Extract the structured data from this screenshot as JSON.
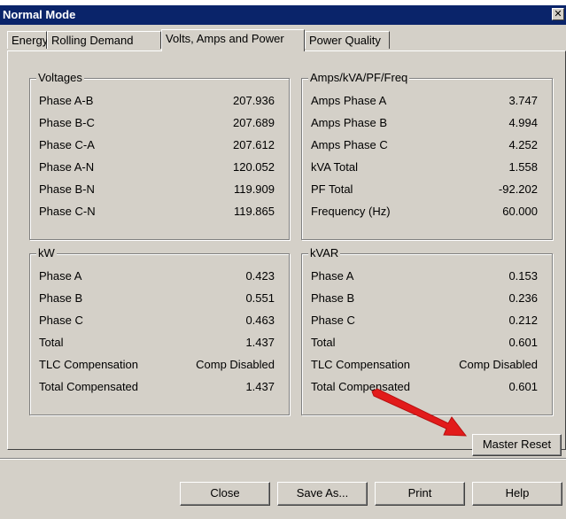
{
  "window": {
    "title": "Normal Mode",
    "close_glyph": "✕"
  },
  "tabs": [
    {
      "label": "Energy"
    },
    {
      "label": "Rolling Demand"
    },
    {
      "label": "Volts, Amps and Power"
    },
    {
      "label": "Power Quality"
    }
  ],
  "voltages": {
    "title": "Voltages",
    "rows": [
      {
        "label": "Phase A-B",
        "value": "207.936"
      },
      {
        "label": "Phase B-C",
        "value": "207.689"
      },
      {
        "label": "Phase C-A",
        "value": "207.612"
      },
      {
        "label": "Phase A-N",
        "value": "120.052"
      },
      {
        "label": "Phase B-N",
        "value": "119.909"
      },
      {
        "label": "Phase C-N",
        "value": "119.865"
      }
    ]
  },
  "amps": {
    "title": "Amps/kVA/PF/Freq",
    "rows": [
      {
        "label": "Amps Phase A",
        "value": "3.747"
      },
      {
        "label": "Amps Phase B",
        "value": "4.994"
      },
      {
        "label": "Amps Phase C",
        "value": "4.252"
      },
      {
        "label": "kVA Total",
        "value": "1.558"
      },
      {
        "label": "PF Total",
        "value": "-92.202"
      },
      {
        "label": "Frequency (Hz)",
        "value": "60.000"
      }
    ]
  },
  "kw": {
    "title": "kW",
    "rows": [
      {
        "label": "Phase A",
        "value": "0.423"
      },
      {
        "label": "Phase B",
        "value": "0.551"
      },
      {
        "label": "Phase C",
        "value": "0.463"
      },
      {
        "label": "Total",
        "value": "1.437"
      },
      {
        "label": "TLC Compensation",
        "value": "Comp Disabled"
      },
      {
        "label": "Total Compensated",
        "value": "1.437"
      }
    ]
  },
  "kvar": {
    "title": "kVAR",
    "rows": [
      {
        "label": "Phase A",
        "value": "0.153"
      },
      {
        "label": "Phase B",
        "value": "0.236"
      },
      {
        "label": "Phase C",
        "value": "0.212"
      },
      {
        "label": "Total",
        "value": "0.601"
      },
      {
        "label": "TLC Compensation",
        "value": "Comp Disabled"
      },
      {
        "label": "Total Compensated",
        "value": "0.601"
      }
    ]
  },
  "buttons": {
    "master_reset": "Master Reset",
    "close": "Close",
    "save_as": "Save As...",
    "print": "Print",
    "help": "Help"
  },
  "colors": {
    "titlebar": "#0a246a",
    "dialog_bg": "#d4d0c8",
    "annotation_arrow": "#e21b1b"
  },
  "icons": {
    "close": "close-icon",
    "annotation": "red-arrow-annotation"
  }
}
